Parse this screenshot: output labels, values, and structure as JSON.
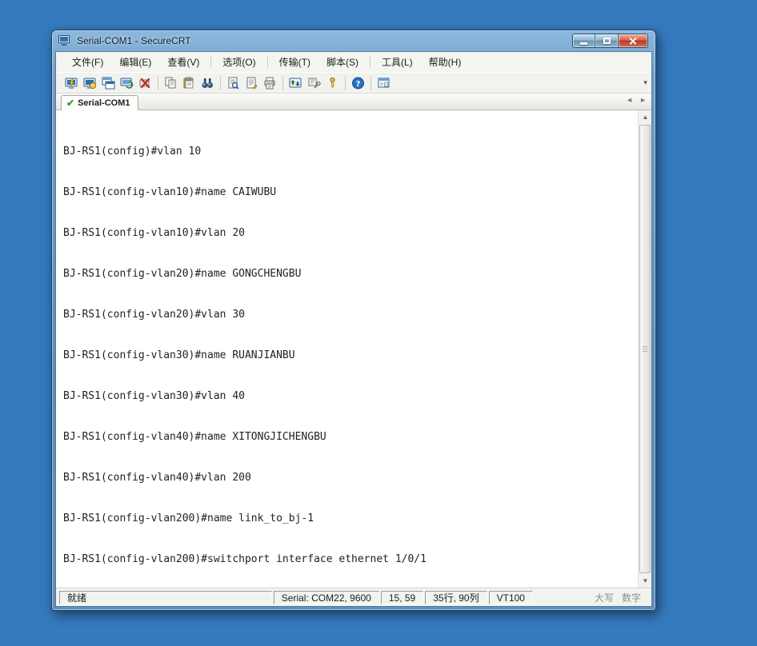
{
  "window": {
    "title": "Serial-COM1 - SecureCRT"
  },
  "menu": {
    "items": [
      {
        "label": "文件(F)"
      },
      {
        "label": "编辑(E)"
      },
      {
        "label": "查看(V)"
      },
      {
        "label": "选项(O)"
      },
      {
        "label": "传输(T)"
      },
      {
        "label": "脚本(S)"
      },
      {
        "label": "工具(L)"
      },
      {
        "label": "帮助(H)"
      }
    ]
  },
  "toolbar": {
    "icons": [
      "quick-connect-icon",
      "connect-icon",
      "connect-in-tab-icon",
      "reconnect-icon",
      "disconnect-icon",
      "copy-icon",
      "paste-icon",
      "find-icon",
      "print-preview-icon",
      "page-setup-icon",
      "print-icon",
      "file-transfer-icon",
      "session-options-icon",
      "key-icon",
      "help-icon",
      "session-manager-icon"
    ]
  },
  "tabs": {
    "active_label": "Serial-COM1"
  },
  "terminal": {
    "lines": [
      "BJ-RS1(config)#vlan 10",
      "BJ-RS1(config-vlan10)#name CAIWUBU",
      "BJ-RS1(config-vlan10)#vlan 20",
      "BJ-RS1(config-vlan20)#name GONGCHENGBU",
      "BJ-RS1(config-vlan20)#vlan 30",
      "BJ-RS1(config-vlan30)#name RUANJIANBU",
      "BJ-RS1(config-vlan30)#vlan 40",
      "BJ-RS1(config-vlan40)#name XITONGJICHENGBU",
      "BJ-RS1(config-vlan40)#vlan 200",
      "BJ-RS1(config-vlan200)#name link_to_bj-1",
      "BJ-RS1(config-vlan200)#switchport interface ethernet 1/0/1"
    ]
  },
  "statusbar": {
    "ready": "就绪",
    "serial": "Serial: COM22, 9600",
    "cursor": "15, 59",
    "size": "35行, 90列",
    "emulation": "VT100",
    "caps": "大写",
    "num": "数字"
  },
  "colors": {
    "desktop": "#3579be",
    "close_button": "#c0402a",
    "check_green": "#2e9e2e",
    "terminal_bg": "#ffffff",
    "terminal_text": "#222222"
  }
}
